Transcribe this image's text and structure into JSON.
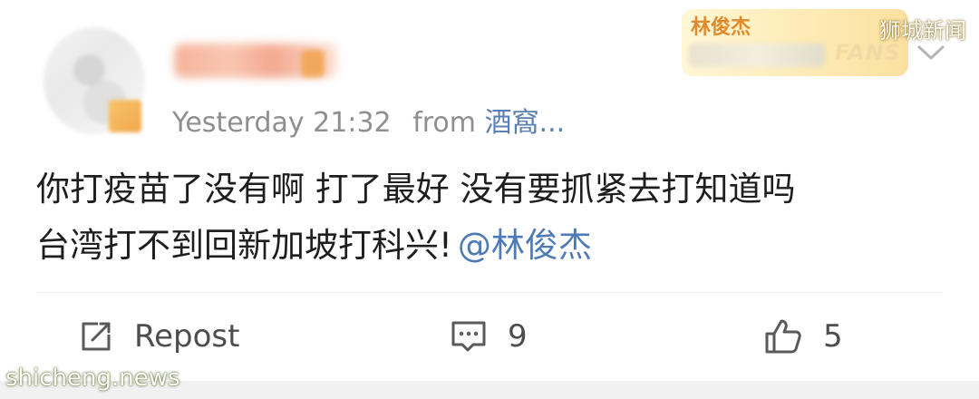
{
  "post": {
    "time": "Yesterday 21:32",
    "from_label": "from",
    "source": "酒窩...",
    "text_line1": "你打疫苗了没有啊 打了最好 没有要抓紧去打知道吗",
    "text_line2": "台湾打不到回新加坡打科兴!",
    "mention": "@林俊杰"
  },
  "fan_badge": {
    "name": "林俊杰",
    "label": "FANS"
  },
  "actions": {
    "repost_label": "Repost",
    "comment_count": "9",
    "like_count": "5"
  },
  "watermarks": {
    "top": "狮城新闻",
    "bottom": "shicheng.news"
  },
  "colors": {
    "link": "#4d7bb8",
    "meta_gray": "#8f8f8f",
    "badge_orange": "#e08a2c"
  }
}
